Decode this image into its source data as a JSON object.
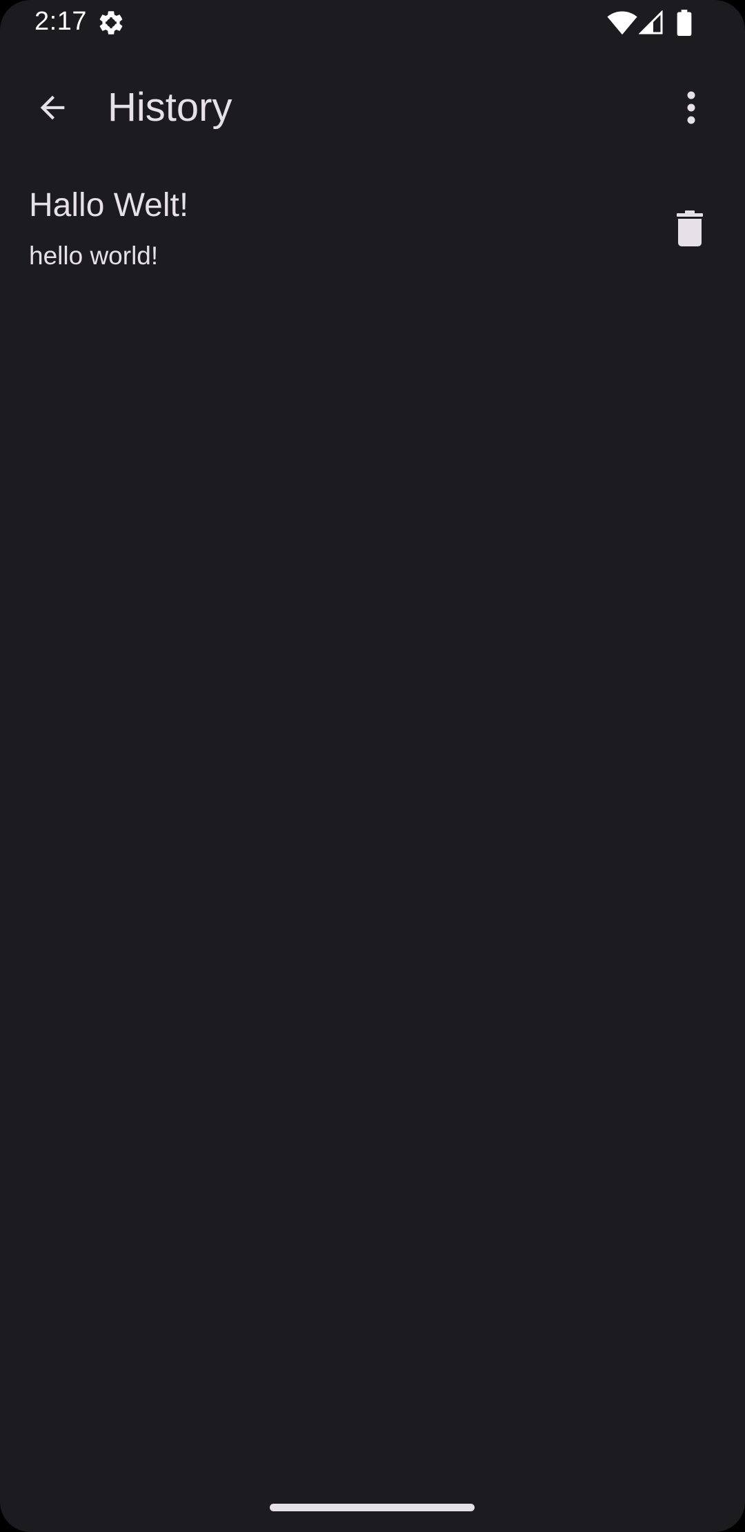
{
  "status_bar": {
    "time": "2:17",
    "icons": [
      "gear-icon",
      "wifi-icon",
      "signal-icon",
      "battery-icon"
    ]
  },
  "app_bar": {
    "title": "History",
    "back_icon": "arrow-back-icon",
    "menu_icon": "more-vert-icon"
  },
  "history": {
    "items": [
      {
        "source": "Hallo Welt!",
        "translation": "hello world!",
        "action_icon": "delete-icon"
      }
    ]
  },
  "colors": {
    "background": "#1c1b20",
    "text": "#e6e1e6",
    "status_text": "#ffffff"
  }
}
